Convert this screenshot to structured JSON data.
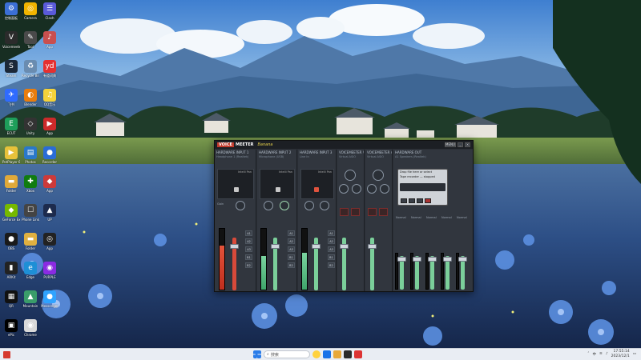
{
  "desktop": {
    "icons": [
      {
        "label": "控制面板",
        "color": "#3b6fd6",
        "glyph": "⚙"
      },
      {
        "label": "Voicemeeter Potato",
        "color": "#2b2b2b",
        "glyph": "V"
      },
      {
        "label": "Steam",
        "color": "#1b2838",
        "glyph": "S"
      },
      {
        "label": "飞书",
        "color": "#2f6bff",
        "glyph": "✈"
      },
      {
        "label": "ECUT",
        "color": "#1e9e5a",
        "glyph": "E"
      },
      {
        "label": "PotPlayer 64bit",
        "color": "#e7c23a",
        "glyph": "▶"
      },
      {
        "label": "Folder",
        "color": "#e0a93a",
        "glyph": "▬"
      },
      {
        "label": "GeForce Experience",
        "color": "#76b900",
        "glyph": "◆"
      },
      {
        "label": "OBS",
        "color": "#1a1a1a",
        "glyph": "●"
      },
      {
        "label": "ARKit",
        "color": "#222",
        "glyph": "▮"
      },
      {
        "label": "QR",
        "color": "#111",
        "glyph": "▦"
      },
      {
        "label": "ePic",
        "color": "#000",
        "glyph": "▣"
      },
      {
        "label": "Camera",
        "color": "#f0b400",
        "glyph": "◎"
      },
      {
        "label": "Tool",
        "color": "#4a4a4a",
        "glyph": "✎"
      },
      {
        "label": "Recycle Bin",
        "color": "#6a8cb0",
        "glyph": "♻"
      },
      {
        "label": "Blender",
        "color": "#e87d0d",
        "glyph": "◐"
      },
      {
        "label": "Unity",
        "color": "#333",
        "glyph": "◇"
      },
      {
        "label": "Photos",
        "color": "#2a78c9",
        "glyph": "▤"
      },
      {
        "label": "Xbox",
        "color": "#107c10",
        "glyph": "✚"
      },
      {
        "label": "Phone Link",
        "color": "#444",
        "glyph": "☐"
      },
      {
        "label": "Folder",
        "color": "#e0b040",
        "glyph": "▬"
      },
      {
        "label": "Edge",
        "color": "#1e8fd6",
        "glyph": "e"
      },
      {
        "label": "Mountain",
        "color": "#3a9d6a",
        "glyph": "▲"
      },
      {
        "label": "Chrome",
        "color": "#d9d9d9",
        "glyph": "◉"
      },
      {
        "label": "Clash",
        "color": "#5a5ad9",
        "glyph": "☰"
      },
      {
        "label": "App",
        "color": "#c94f4f",
        "glyph": "♪"
      },
      {
        "label": "有道词典",
        "color": "#e53030",
        "glyph": "yd"
      },
      {
        "label": "QQ音乐",
        "color": "#f4d23a",
        "glyph": "♫"
      },
      {
        "label": "App",
        "color": "#cc2a2a",
        "glyph": "▶"
      },
      {
        "label": "Recorder",
        "color": "#2a6cd6",
        "glyph": "●"
      },
      {
        "label": "App",
        "color": "#cc3a3a",
        "glyph": "◆"
      },
      {
        "label": "UP",
        "color": "#1d2b4d",
        "glyph": "▲"
      },
      {
        "label": "App",
        "color": "#222",
        "glyph": "◎"
      },
      {
        "label": "PURPLE",
        "color": "#8a2be2",
        "glyph": "◉"
      },
      {
        "label": "Messenger",
        "color": "#2fa3ff",
        "glyph": "●"
      }
    ]
  },
  "voicemeeter": {
    "brand_a": "VOICE",
    "brand_b": "MEETER",
    "brand_c": "Banana",
    "input1": {
      "name": "HARDWARE INPUT 1",
      "sub": "Headphone 1 (Realtek)",
      "panel_cap": "Intelli Pan",
      "gain_label": "Gain",
      "comp_label": "Comp"
    },
    "input2": {
      "name": "HARDWARE INPUT 2",
      "sub": "Microphone (USB)",
      "panel_cap": "Intelli Pan"
    },
    "input3": {
      "name": "HARDWARE INPUT 3",
      "sub": "Line In",
      "panel_cap": "Intelli Pan"
    },
    "virtual1": {
      "name": "VOICEMEETER VAIO",
      "sub": "Virtual ASIO"
    },
    "virtual2": {
      "name": "VOICEMEETER AUX",
      "sub": "Virtual ASIO"
    },
    "hw_out": {
      "name": "HARDWARE OUT",
      "sub": "A1 Speakers (Realtek)"
    },
    "tape": {
      "line1": "Drop file here or select",
      "line2": "Tape recorder — stopped"
    },
    "bus_labels": [
      "A1",
      "A2",
      "A3",
      "B1",
      "B2"
    ],
    "strip_buttons": [
      "MONO",
      "SOLO",
      "MUTE"
    ],
    "out_labels": [
      "Normal",
      "Normal",
      "Normal",
      "Normal",
      "Normal"
    ],
    "title_buttons": [
      "MENU",
      "_",
      "×"
    ],
    "meters": {
      "in1": 0.72,
      "in2": 0.55,
      "in3": 0.6
    },
    "faders": {
      "in1": 0.62,
      "in2": 0.62,
      "in3": 0.62,
      "v1": 0.62,
      "v2": 0.62
    }
  },
  "taskbar": {
    "search_placeholder": "搜索",
    "time": "17:55:14",
    "date": "2023/12/1",
    "tray_lang": "中"
  }
}
